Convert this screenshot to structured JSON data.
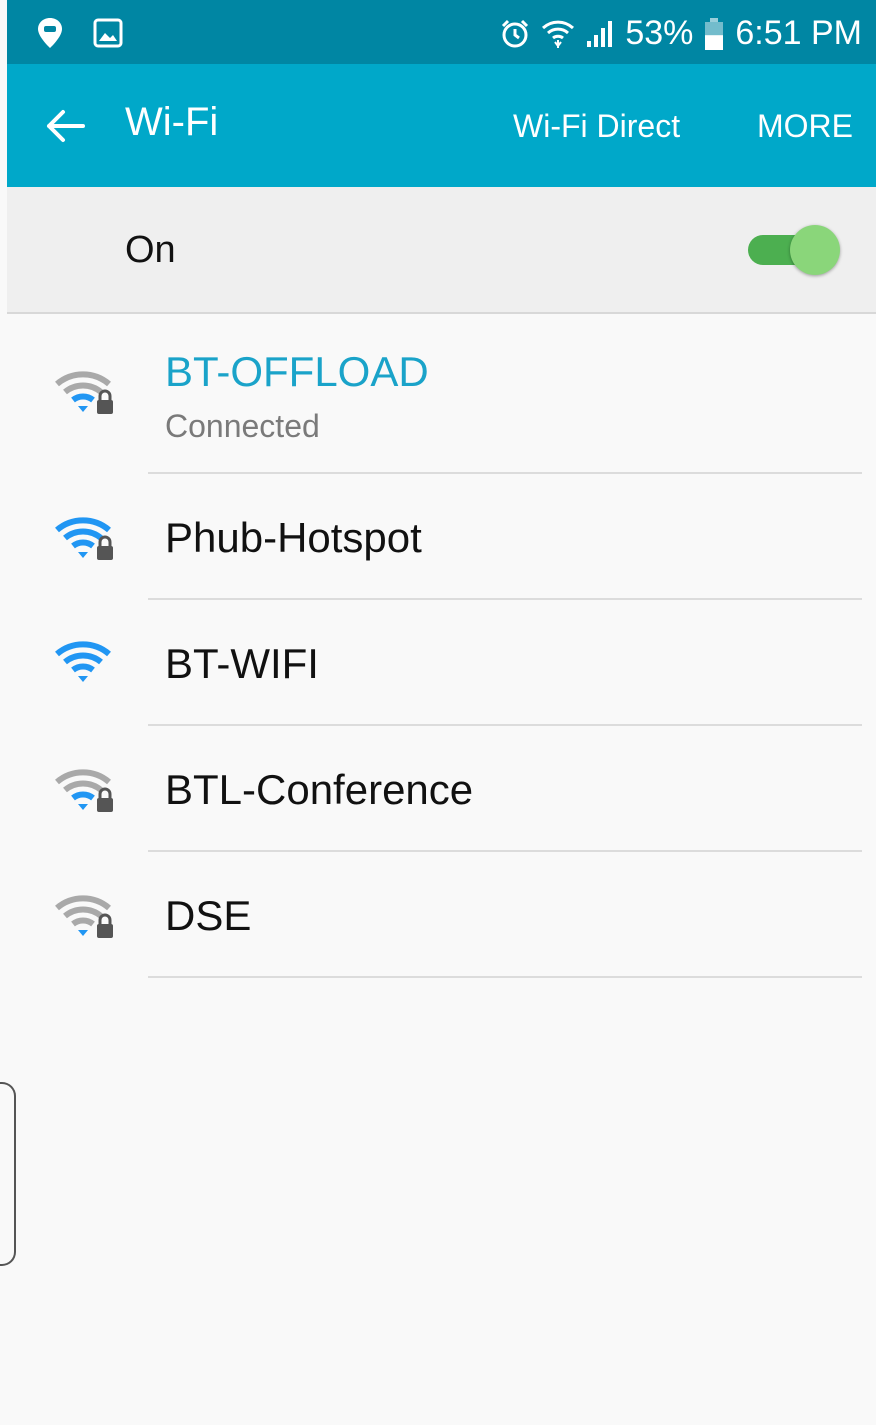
{
  "status_bar": {
    "battery_text": "53%",
    "time": "6:51 PM",
    "battery_level": 0.53,
    "icons": [
      "location-icon",
      "image-icon",
      "alarm-icon",
      "wifi-status-icon",
      "signal-icon",
      "battery-icon"
    ]
  },
  "app_bar": {
    "title": "Wi-Fi",
    "actions": {
      "wifi_direct": "Wi-Fi Direct",
      "more": "MORE"
    }
  },
  "toggle": {
    "label": "On",
    "enabled": true
  },
  "networks": [
    {
      "name": "BT-OFFLOAD",
      "status": "Connected",
      "secured": true,
      "signal_color": "gray",
      "name_color": "#1aa3c9"
    },
    {
      "name": "Phub-Hotspot",
      "secured": true,
      "signal_color": "blue"
    },
    {
      "name": "BT-WIFI",
      "secured": false,
      "signal_color": "blue"
    },
    {
      "name": "BTL-Conference",
      "secured": true,
      "signal_color": "gray"
    },
    {
      "name": "DSE",
      "secured": true,
      "signal_color": "gray"
    }
  ],
  "colors": {
    "status_bar": "#0086a3",
    "app_bar": "#00a8c9",
    "accent": "#1aa3c9",
    "signal_blue": "#2196f3",
    "signal_gray": "#a9a9a9",
    "switch_on": "#4caf50"
  }
}
